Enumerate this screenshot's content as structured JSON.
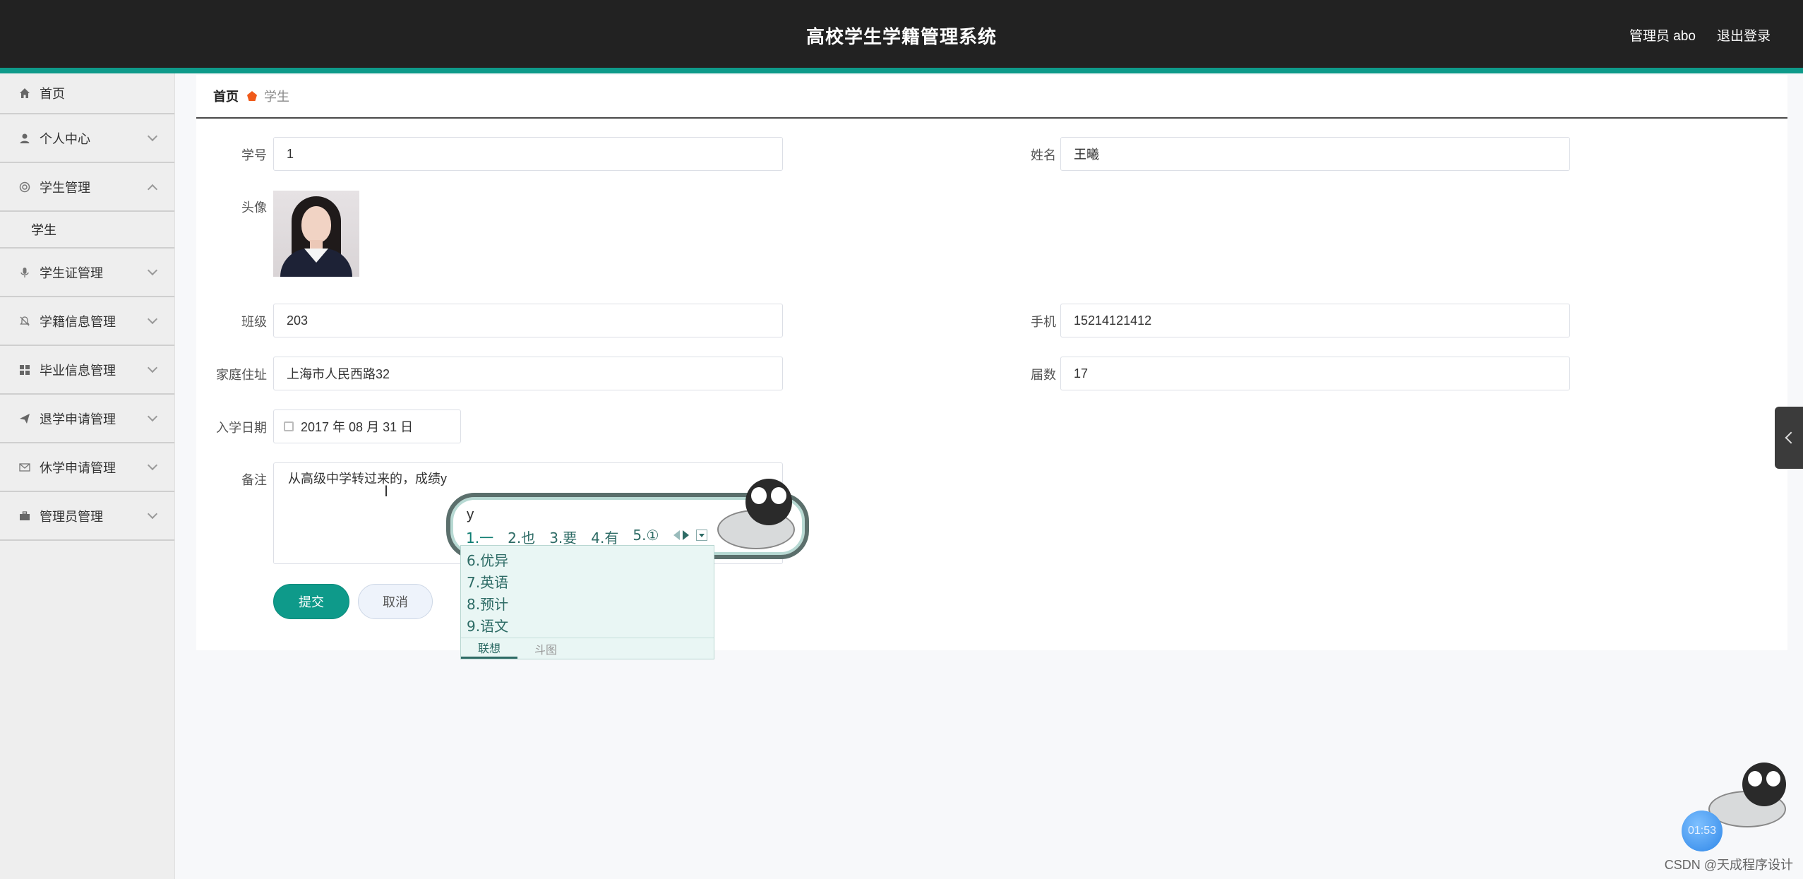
{
  "header": {
    "title": "高校学生学籍管理系统",
    "admin_label": "管理员 abo",
    "logout_label": "退出登录"
  },
  "sidebar": {
    "items": [
      {
        "label": "首页",
        "icon": "home-icon"
      },
      {
        "label": "个人中心",
        "icon": "user-icon"
      },
      {
        "label": "学生管理",
        "icon": "student-icon",
        "expanded": true
      },
      {
        "label": "学生证管理",
        "icon": "microphone-icon"
      },
      {
        "label": "学籍信息管理",
        "icon": "bell-icon"
      },
      {
        "label": "毕业信息管理",
        "icon": "grid-icon"
      },
      {
        "label": "退学申请管理",
        "icon": "send-icon"
      },
      {
        "label": "休学申请管理",
        "icon": "mail-icon"
      },
      {
        "label": "管理员管理",
        "icon": "briefcase-icon"
      }
    ],
    "sub_item": "学生"
  },
  "breadcrumb": {
    "home": "首页",
    "current": "学生"
  },
  "form": {
    "student_id_label": "学号",
    "student_id_value": "1",
    "name_label": "姓名",
    "name_value": "王曦",
    "avatar_label": "头像",
    "class_label": "班级",
    "class_value": "203",
    "phone_label": "手机",
    "phone_value": "15214121412",
    "address_label": "家庭住址",
    "address_value": "上海市人民西路32",
    "session_label": "届数",
    "session_value": "17",
    "enroll_date_label": "入学日期",
    "enroll_date_value": "2017 年 08 月 31 日",
    "remark_label": "备注",
    "remark_value": "从高级中学转过来的，成绩y",
    "submit_label": "提交",
    "cancel_label": "取消"
  },
  "ime": {
    "composition": "y",
    "row_candidates": [
      "1.一",
      "2.也",
      "3.要",
      "4.有",
      "5.①"
    ],
    "list_candidates": [
      "6.优异",
      "7.英语",
      "8.预计",
      "9.语文"
    ],
    "tab_active": "联想",
    "tab_other": "斗图"
  },
  "overlay": {
    "timer": "01:53",
    "watermark": "CSDN @天成程序设计"
  }
}
